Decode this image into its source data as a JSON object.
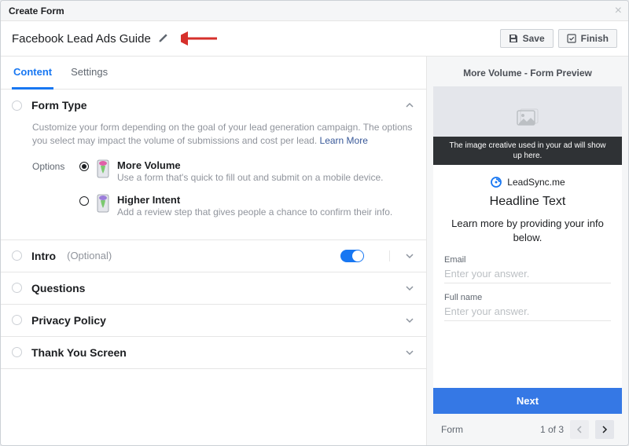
{
  "modal": {
    "title": "Create Form"
  },
  "form": {
    "name": "Facebook Lead Ads Guide"
  },
  "actions": {
    "save": "Save",
    "finish": "Finish"
  },
  "tabs": {
    "content": "Content",
    "settings": "Settings"
  },
  "sections": {
    "formType": {
      "title": "Form Type",
      "desc": "Customize your form depending on the goal of your lead generation campaign. The options you select may impact the volume of submissions and cost per lead. ",
      "learnMore": "Learn More",
      "optionsLabel": "Options",
      "options": [
        {
          "title": "More Volume",
          "desc": "Use a form that's quick to fill out and submit on a mobile device.",
          "selected": true
        },
        {
          "title": "Higher Intent",
          "desc": "Add a review step that gives people a chance to confirm their info.",
          "selected": false
        }
      ]
    },
    "intro": {
      "title": "Intro",
      "optional": "(Optional)"
    },
    "questions": {
      "title": "Questions"
    },
    "privacy": {
      "title": "Privacy Policy"
    },
    "thanks": {
      "title": "Thank You Screen"
    }
  },
  "preview": {
    "heading": "More Volume - Form Preview",
    "imageCaption": "The image creative used in your ad will show up here.",
    "brand": "LeadSync.me",
    "headline": "Headline Text",
    "subline": "Learn more by providing your info below.",
    "fields": [
      {
        "label": "Email",
        "placeholder": "Enter your answer."
      },
      {
        "label": "Full name",
        "placeholder": "Enter your answer."
      }
    ],
    "nextLabel": "Next",
    "footerLabel": "Form",
    "pageLabel": "1 of 3"
  }
}
